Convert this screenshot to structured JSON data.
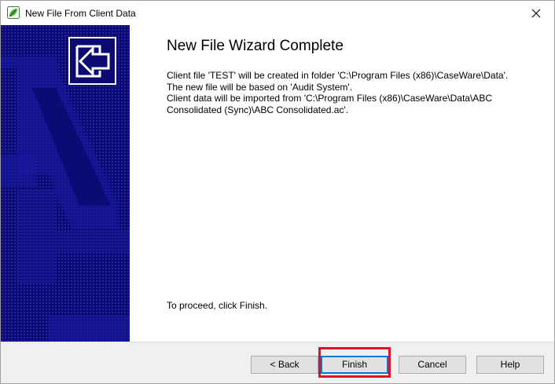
{
  "window": {
    "title": "New File From Client Data",
    "app_icon": "caseware-leaf-icon",
    "close_icon": "close-icon"
  },
  "wizard": {
    "heading": "New File Wizard Complete",
    "message_lines": [
      "Client file 'TEST' will be created in folder 'C:\\Program Files (x86)\\CaseWare\\Data'.",
      "The new file will be based on 'Audit System'.",
      "Client data will be imported from 'C:\\Program Files (x86)\\CaseWare\\Data\\ABC",
      "Consolidated (Sync)\\ABC Consolidated.ac'."
    ],
    "proceed_text": "To proceed, click Finish.",
    "side_icon": "wizard-new-file-icon"
  },
  "buttons": {
    "back": "< Back",
    "finish": "Finish",
    "cancel": "Cancel",
    "help": "Help"
  },
  "colors": {
    "side_panel": "#0b0b73",
    "highlight": "#e0102a",
    "default_button_border": "#0078d7"
  }
}
